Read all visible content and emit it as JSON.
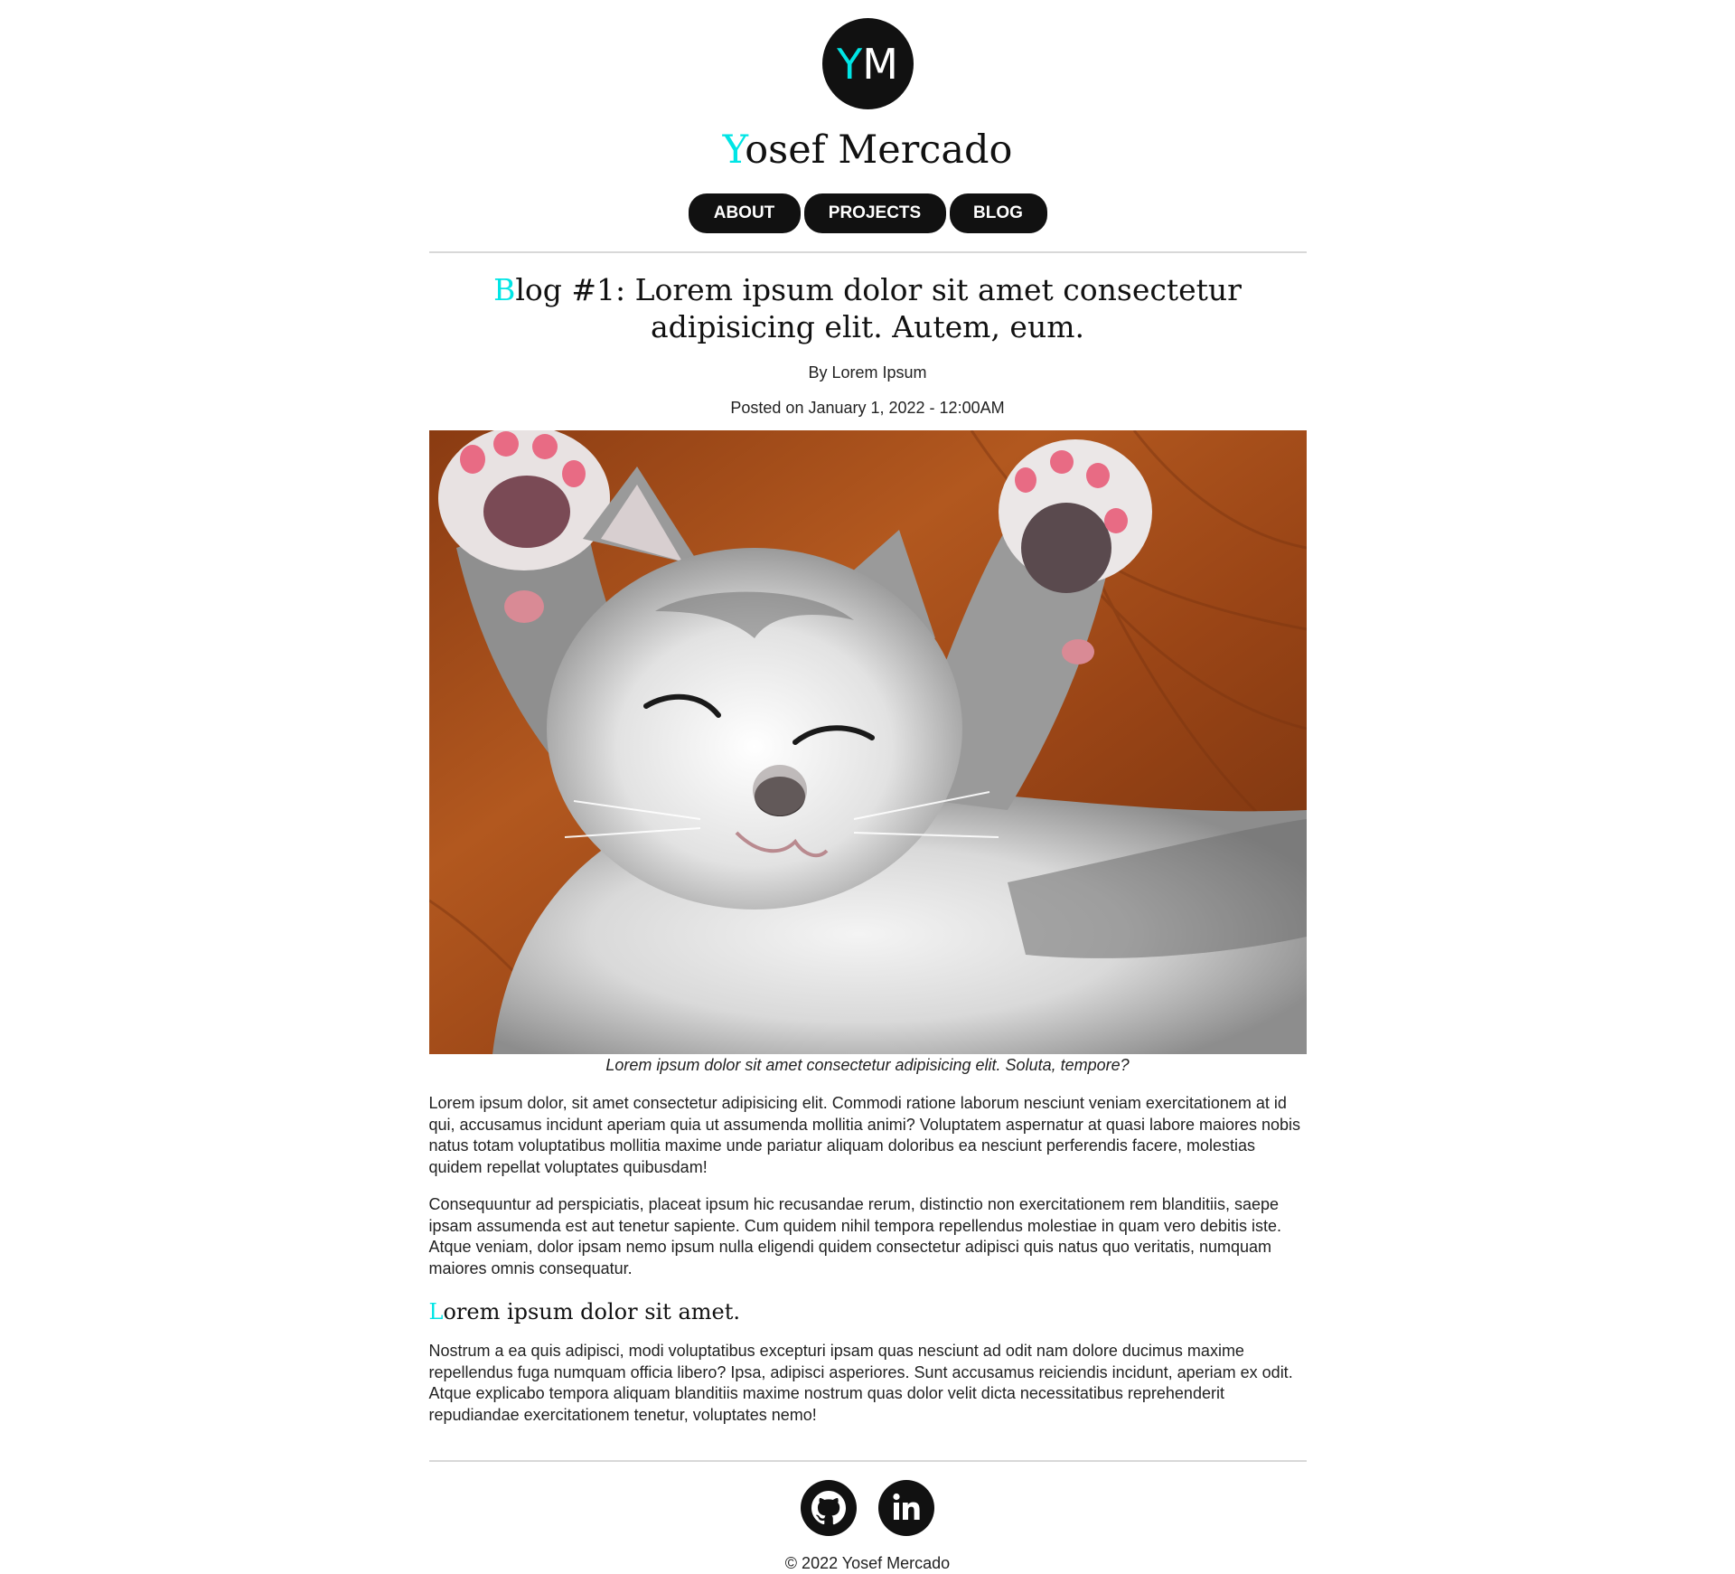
{
  "header": {
    "logo_first": "Y",
    "logo_rest": "M",
    "name_first": "Y",
    "name_rest": "osef Mercado"
  },
  "nav": {
    "about": "ABOUT",
    "projects": "PROJECTS",
    "blog": "BLOG"
  },
  "post": {
    "title_first": "B",
    "title_rest": "log #1: Lorem ipsum dolor sit amet consectetur adipisicing elit. Autem, eum.",
    "byline": "By Lorem Ipsum",
    "posted": "Posted on January 1, 2022 - 12:00AM",
    "image_caption": "Lorem ipsum dolor sit amet consectetur adipisicing elit. Soluta, tempore?",
    "paragraphs": [
      "Lorem ipsum dolor, sit amet consectetur adipisicing elit. Commodi ratione laborum nesciunt veniam exercitationem at id qui, accusamus incidunt aperiam quia ut assumenda mollitia animi? Voluptatem aspernatur at quasi labore maiores nobis natus totam voluptatibus mollitia maxime unde pariatur aliquam doloribus ea nesciunt perferendis facere, molestias quidem repellat voluptates quibusdam!",
      "Consequuntur ad perspiciatis, placeat ipsum hic recusandae rerum, distinctio non exercitationem rem blanditiis, saepe ipsam assumenda est aut tenetur sapiente. Cum quidem nihil tempora repellendus molestiae in quam vero debitis iste. Atque veniam, dolor ipsam nemo ipsum nulla eligendi quidem consectetur adipisci quis natus quo veritatis, numquam maiores omnis consequatur.",
      "Nostrum a ea quis adipisci, modi voluptatibus excepturi ipsam quas nesciunt ad odit nam dolore ducimus maxime repellendus fuga numquam officia libero? Ipsa, adipisci asperiores. Sunt accusamus reiciendis incidunt, aperiam ex odit. Atque explicabo tempora aliquam blanditiis maxime nostrum quas dolor velit dicta necessitatibus reprehenderit repudiandae exercitationem tenetur, voluptates nemo!"
    ],
    "subheading_first": "L",
    "subheading_rest": "orem ipsum dolor sit amet."
  },
  "footer": {
    "copyright": "© 2022 Yosef Mercado",
    "icons": [
      "github-icon",
      "linkedin-icon"
    ]
  },
  "colors": {
    "accent": "#00e5e5",
    "dark": "#111111",
    "divider": "#d8d8d8"
  }
}
